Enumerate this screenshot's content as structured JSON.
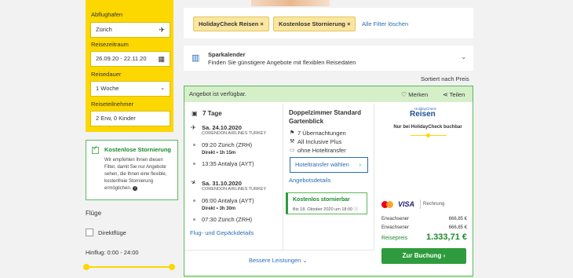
{
  "sidebar": {
    "departure_label": "Abflughafen",
    "departure_value": "Zürich",
    "travel_period_label": "Reisezeitraum",
    "travel_period_value": "26.09.20 - 22.11.20",
    "duration_label": "Reisedauer",
    "duration_value": "1 Woche",
    "travelers_label": "Reiseteilnehmer",
    "travelers_value": "2 Erw, 0 Kinder",
    "cancel_filter": {
      "title": "Kostenlose Stornierung",
      "desc": "Wir empfehlen Ihnen diesen Filter, damit Sie nur Angebote sehen, die Ihnen eine flexible, kostenfreie Stornierung ermöglichen."
    },
    "flights_title": "Flüge",
    "direct_flight_label": "Direktflüge",
    "outbound_label": "Hinflug: 0:00 - 24:00"
  },
  "filters": {
    "chips": [
      "HolidayCheck Reisen ×",
      "Kostenlose Stornierung ×"
    ],
    "clear_all": "Alle Filter löschen"
  },
  "savings": {
    "title": "Sparkalender",
    "subtitle": "Finden Sie günstigere Angebote mit flexiblen Reisedaten"
  },
  "sort_label": "Sortiert nach Preis",
  "offer": {
    "available": "Angebot ist verfügbar.",
    "remember": "Merken",
    "share": "Teilen",
    "days": "7 Tage",
    "outbound": {
      "date": "Sa. 24.10.2020",
      "airline": "CORENDON AIRLINES TURKEY",
      "dep": "09:20 Zürich (ZRH)",
      "direct": "Direkt",
      "dur": "1h 15m",
      "arr": "13:35 Antalya (AYT)"
    },
    "return": {
      "date": "Sa. 31.10.2020",
      "airline": "CORENDON AIRLINES TURKEY",
      "dep": "06:00 Antalya (AYT)",
      "direct": "Direkt",
      "dur": "3h 30m",
      "arr": "07:30 Zürich (ZRH)"
    },
    "flight_details": "Flug- und Gepäckdetails",
    "room": "Doppelzimmer Standard Gartenblick",
    "nights": "7 Übernachtungen",
    "board": "All Inclusive Plus",
    "transfer": "ohne Hoteltransfer",
    "transfer_btn": "Hoteltransfer wählen",
    "offer_details": "Angebotsdetails",
    "cancel_title": "Kostenlos stornierbar",
    "cancel_until": "Bis 18. Oktober 2020 um 18:00",
    "brand_small": "HolidayCheck",
    "brand": "Reisen",
    "brand_note": "Nur bei HolidayCheck buchbar",
    "visa": "VISA",
    "invoice": "Rechnung",
    "adult_label": "Erwachsener",
    "adult1_price": "666,85 €",
    "adult2_price": "666,85 €",
    "total_label": "Reisepreis",
    "total": "1.333,71 €",
    "book": "Zur Buchung",
    "more": "Bessere Leistungen"
  },
  "colors": {
    "accent_yellow": "#fcd700",
    "green": "#2e9b3c",
    "link": "#2a6db5"
  }
}
